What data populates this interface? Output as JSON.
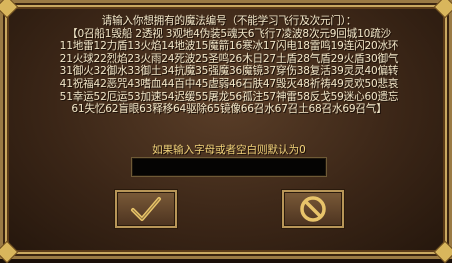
{
  "dialog": {
    "message_lines": [
      "请输入你想拥有的魔法编号（不能学习飞行及次元门）：",
      "【0召船1毁船 2透视 3观地4伪装5魂天6飞行7凌波8次元9回城10疏沙",
      "11地雷12力盾13火焰14地波15魔箭16寒冰17闪电18雷鸣19连闪20冰环",
      "21火球22烈焰23火雨24死波25圣鸣26木日27土盾28气盾29火盾30御气",
      "31御火32御水33御土34抗魔35强魔36魔镜37穿伤38复活39灵灵40偏转",
      "41祝福42恶咒43嗜血44百中45虚弱46石肤47毁灭48祈祷49灵欢50悲哀",
      "51幸运52厄运53加速54迟缓55屠龙56孤注57神雷58反戈59迷心60遗忘",
      "61失忆62盲眼63释移64驱除65镜像66召水67召土68召水69召气】"
    ],
    "hint": "如果输入字母或者空白则默认为0",
    "input_value": "",
    "input_placeholder": "",
    "ok_button_label": "OK",
    "cancel_button_label": "Cancel"
  },
  "colors": {
    "text": "#f1e6c8",
    "hint_text": "#f1d27a",
    "frame_gold": "#c9a860",
    "panel_brown": "#3b2617"
  }
}
